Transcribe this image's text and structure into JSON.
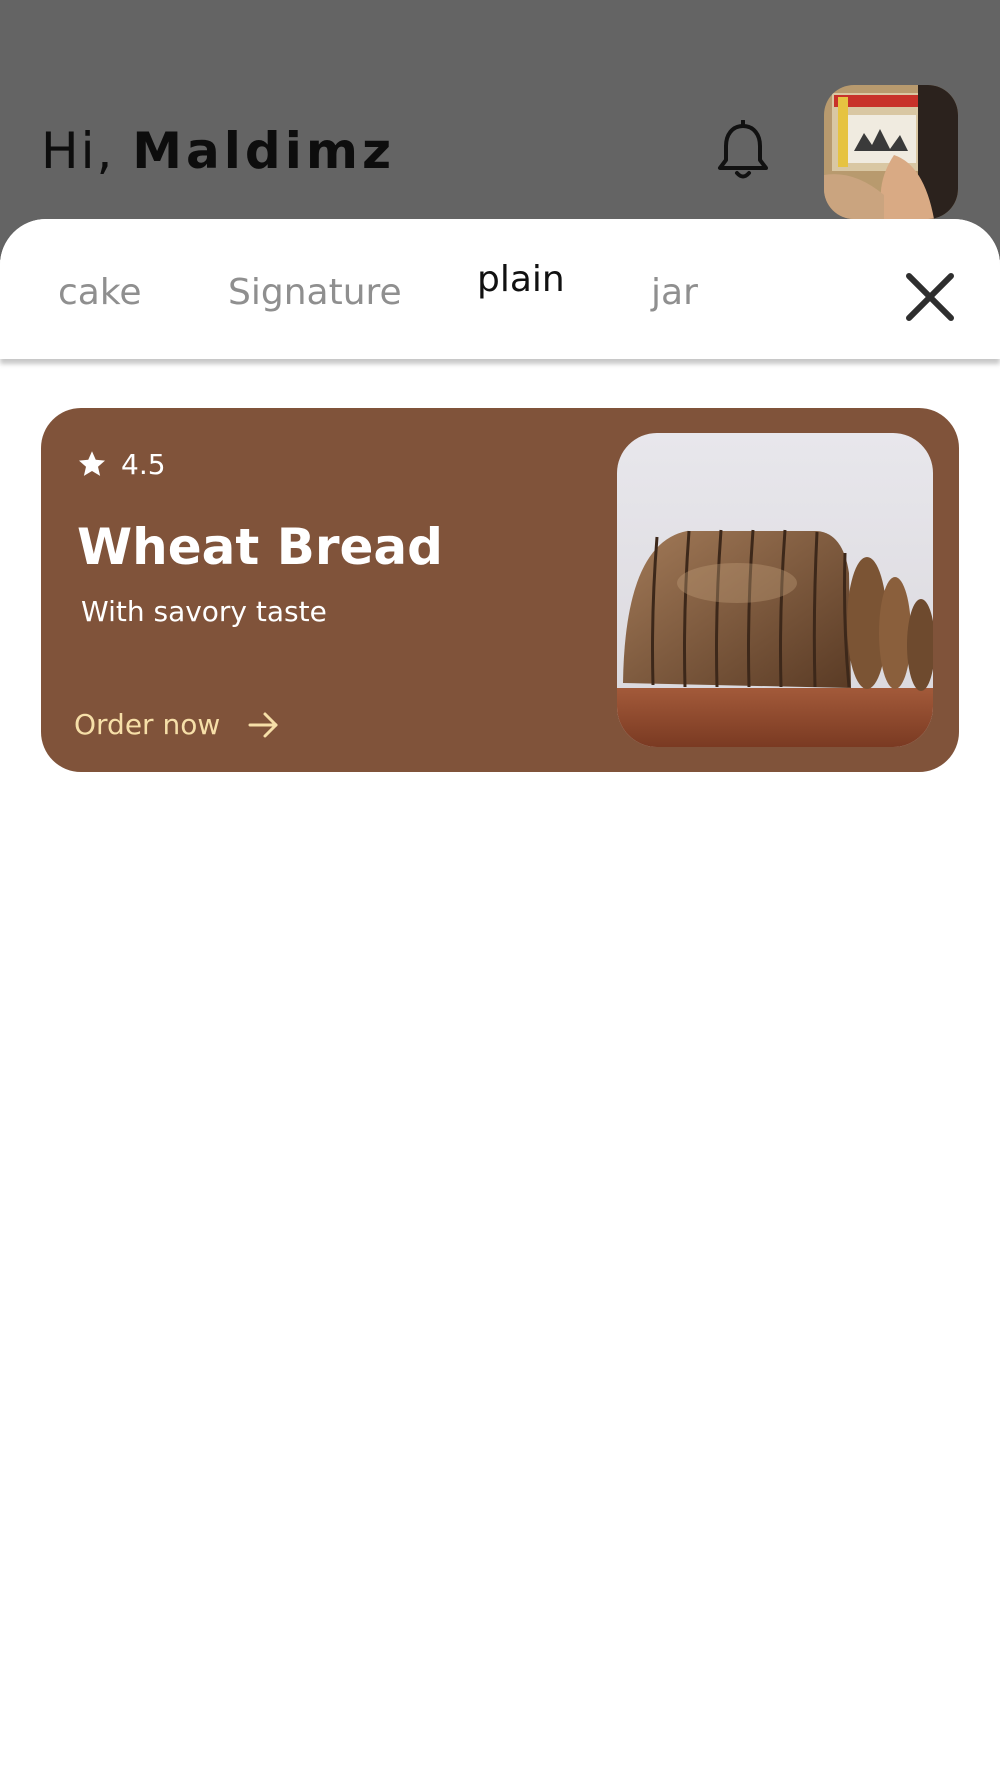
{
  "header": {
    "greeting": "Hi,",
    "user_name": "Maldimz",
    "bell_icon": "bell-icon",
    "avatar": "user-avatar-photo"
  },
  "tabs": [
    {
      "label": "cake",
      "active": false
    },
    {
      "label": "Signature",
      "active": false
    },
    {
      "label": "plain",
      "active": true
    },
    {
      "label": "jar",
      "active": false
    }
  ],
  "close_icon": "close-icon",
  "product": {
    "rating": "4.5",
    "rating_icon": "star-icon",
    "title": "Wheat Bread",
    "subtitle": "With savory taste",
    "cta_label": "Order now",
    "cta_icon": "arrow-right-icon",
    "image": "sliced-wheat-bread-photo"
  },
  "colors": {
    "overlay": "#646464",
    "card_background": "#80533a",
    "cta_text": "#f6dfa8",
    "active_tab": "#111111",
    "inactive_tab": "#8f8f8f"
  }
}
